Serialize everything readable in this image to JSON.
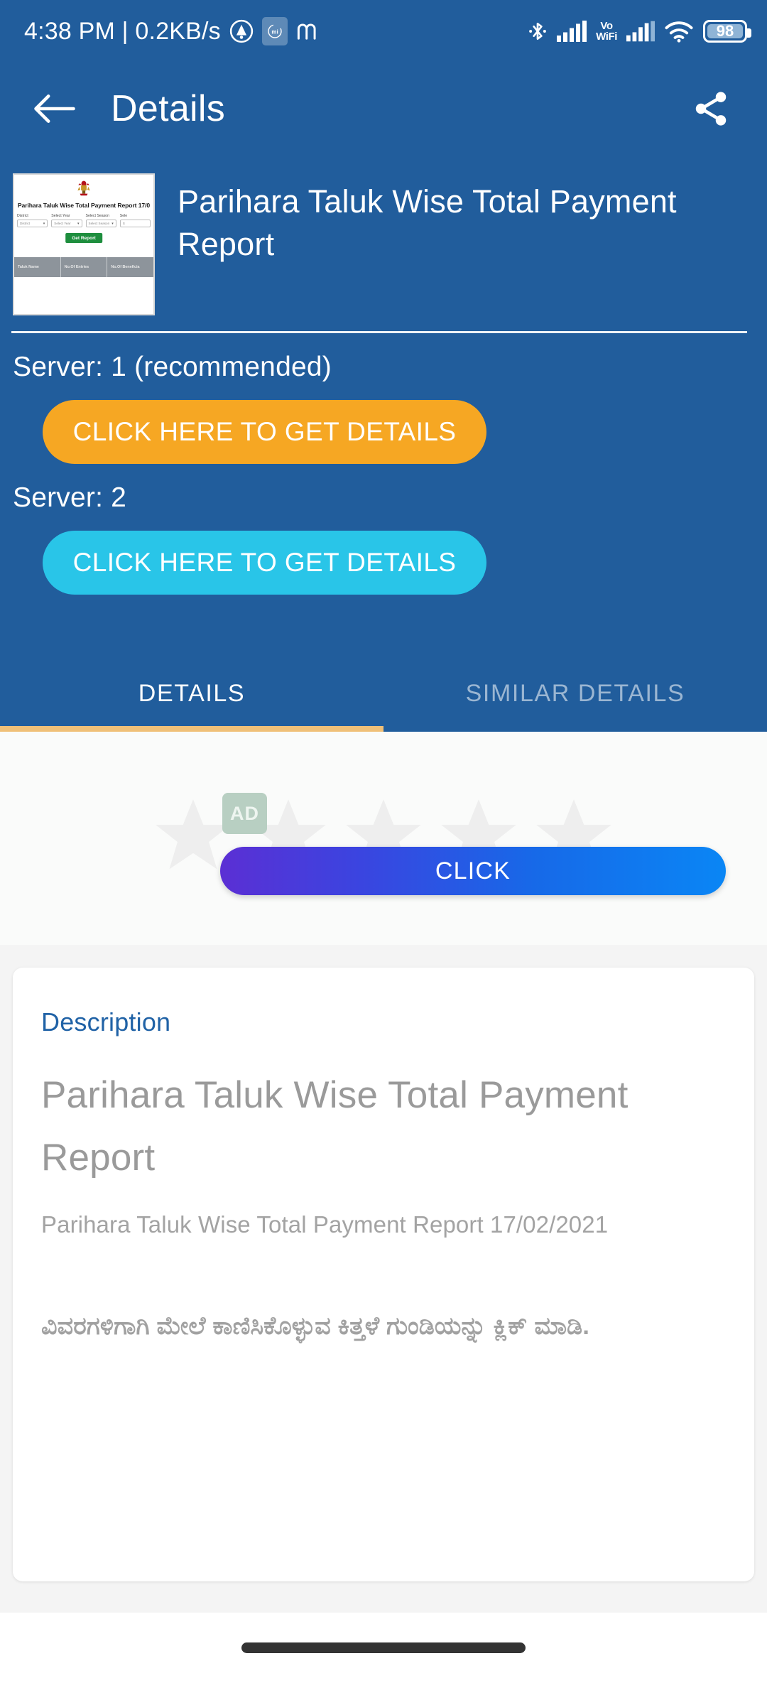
{
  "status_bar": {
    "clock": "4:38 PM | 0.2KB/s",
    "icons_left": [
      "adblock-icon",
      "mi-cleaner-icon",
      "m-app-icon"
    ],
    "mi_badge_label": "mi",
    "icons_right": [
      "bluetooth-icon",
      "signal-bars-icon",
      "vowifi-icon",
      "signal-bars-2-icon",
      "wifi-icon"
    ],
    "vowifi_line1": "Vo",
    "vowifi_line2": "WiFi",
    "battery_level": "98"
  },
  "app_bar": {
    "back_icon": "arrow-left-icon",
    "title": "Details",
    "share_icon": "share-icon"
  },
  "hero": {
    "thumbnail": {
      "emblem": "karnataka-state-emblem",
      "heading": "Parihara Taluk Wise Total Payment Report 17/0",
      "filters": [
        {
          "label": "District",
          "value": "District"
        },
        {
          "label": "Select Year",
          "value": "Select Year"
        },
        {
          "label": "Select Season",
          "value": "Select Season"
        },
        {
          "label": "Sele",
          "value": "S"
        }
      ],
      "submit_label": "Get Report",
      "table_headers": [
        "Taluk Name",
        "No.Of Entries",
        "No.Of Beneficia"
      ]
    },
    "title": "Parihara Taluk Wise Total Payment Report",
    "servers": [
      {
        "label": "Server: 1 (recommended)",
        "button_label": "CLICK HERE TO GET DETAILS",
        "color": "#F6A723"
      },
      {
        "label": "Server: 2",
        "button_label": "CLICK HERE TO GET DETAILS",
        "color": "#29C5E8"
      }
    ]
  },
  "tabs": [
    {
      "label": "DETAILS",
      "active": true
    },
    {
      "label": "SIMILAR DETAILS",
      "active": false
    }
  ],
  "ad": {
    "badge_label": "AD",
    "stars_count": 5,
    "button_label": "CLICK"
  },
  "description": {
    "heading": "Description",
    "title": "Parihara Taluk Wise Total Payment Report",
    "body": "Parihara Taluk Wise Total Payment Report 17/02/2021",
    "kannada_note": "ವಿವರಗಳಿಗಾಗಿ ಮೇಲೆ ಕಾಣಿಸಿಕೊಳ್ಳುವ ಕಿತ್ತಳೆ ಗುಂಡಿಯನ್ನು ಕ್ಲಿಕ್ ಮಾಡಿ."
  },
  "nav_bar": {
    "home_indicator": "home-indicator"
  },
  "colors": {
    "brand_blue": "#215D9C",
    "accent_orange": "#F6A723",
    "accent_cyan": "#29C5E8",
    "tab_indicator": "#F0C078",
    "desc_heading_blue": "#2062A6",
    "page_background": "#F4F4F4"
  }
}
